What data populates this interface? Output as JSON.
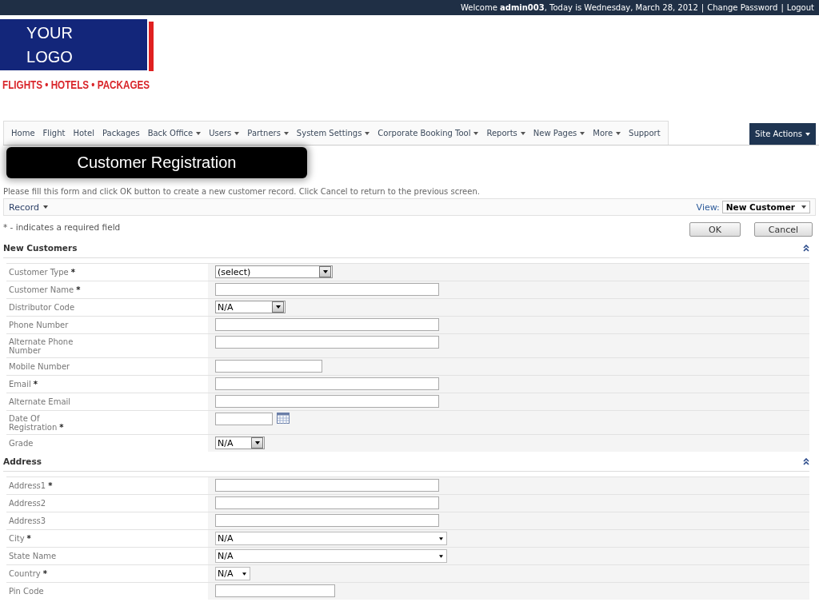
{
  "top_bar": {
    "welcome": "Welcome",
    "user": "admin003",
    "date_text": ", Today is Wednesday, March 28, 2012",
    "separator_1": "|",
    "change_password": "Change Password",
    "separator_2": "|",
    "logout": "Logout"
  },
  "logo": {
    "line_1": "YOUR",
    "line_2": "LOGO",
    "tagline": "FLIGHTS • HOTELS • PACKAGES"
  },
  "nav": {
    "items": [
      {
        "label": "Home",
        "has_menu": false
      },
      {
        "label": "Flight",
        "has_menu": false
      },
      {
        "label": "Hotel",
        "has_menu": false
      },
      {
        "label": "Packages",
        "has_menu": false
      },
      {
        "label": "Back Office",
        "has_menu": true
      },
      {
        "label": "Users",
        "has_menu": true
      },
      {
        "label": "Partners",
        "has_menu": true
      },
      {
        "label": "System Settings",
        "has_menu": true
      },
      {
        "label": "Corporate Booking Tool",
        "has_menu": true
      },
      {
        "label": "Reports",
        "has_menu": true
      },
      {
        "label": "New Pages",
        "has_menu": true
      },
      {
        "label": "More",
        "has_menu": true
      },
      {
        "label": "Support",
        "has_menu": false
      }
    ],
    "site_actions": "Site Actions"
  },
  "callout": "Customer Registration",
  "instructions": "Please fill this form and click OK button to create a new customer record. Click Cancel to return to the previous screen.",
  "toolbar": {
    "record": "Record",
    "view_label": "View:",
    "view_value": "New Customer"
  },
  "required_note": "* - indicates a required field",
  "buttons": [
    "OK",
    "Cancel"
  ],
  "sections": [
    {
      "title": "New Customers",
      "fields": [
        {
          "label": "Customer Type",
          "mark": "*",
          "kind": "select",
          "value": "(select)"
        },
        {
          "label": "Customer Name",
          "mark": "*",
          "kind": "text"
        },
        {
          "label": "Distributor Code",
          "kind": "select",
          "value": "N/A"
        },
        {
          "label": "Phone Number",
          "kind": "text"
        },
        {
          "label": "Alternate Phone Number",
          "kind": "text"
        },
        {
          "label": "Mobile Number",
          "kind": "text"
        },
        {
          "label": "Email",
          "mark": "*",
          "kind": "text"
        },
        {
          "label": "Alternate Email",
          "kind": "text"
        },
        {
          "label": "Date Of Registration",
          "mark": "*",
          "kind": "date"
        },
        {
          "label": "Grade",
          "kind": "select",
          "value": "N/A"
        }
      ]
    },
    {
      "title": "Address",
      "fields": [
        {
          "label": "Address1",
          "mark": "*",
          "kind": "text"
        },
        {
          "label": "Address2",
          "kind": "text"
        },
        {
          "label": "Address3",
          "kind": "text"
        },
        {
          "label": "City",
          "mark": "*",
          "kind": "dropdown",
          "value": "N/A"
        },
        {
          "label": "State Name",
          "kind": "dropdown",
          "value": "N/A"
        },
        {
          "label": "Country",
          "mark": "*",
          "kind": "dropdown",
          "value": "N/A"
        },
        {
          "label": "Pin Code",
          "kind": "text"
        }
      ]
    }
  ]
}
